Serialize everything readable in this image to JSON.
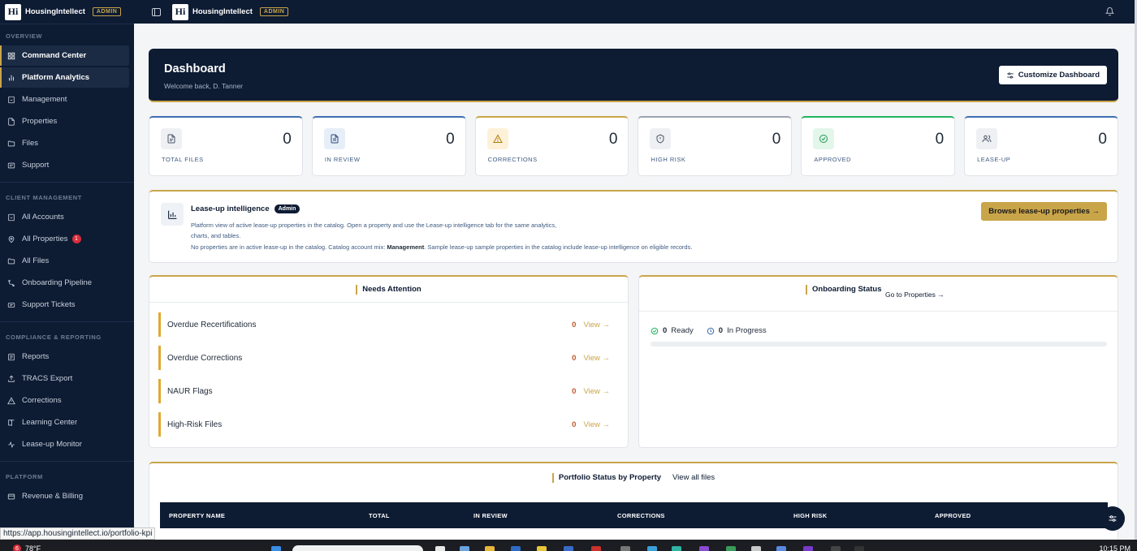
{
  "brand": {
    "name": "HousingIntellect",
    "logo_text": "Hi",
    "role_badge": "ADMIN"
  },
  "sidebar": {
    "sections": [
      {
        "title": "OVERVIEW",
        "items": [
          {
            "label": "Command Center",
            "icon": "grid-icon",
            "active": true
          },
          {
            "label": "Platform Analytics",
            "icon": "bar-chart-icon",
            "active": true
          },
          {
            "label": "Management",
            "icon": "building-icon"
          },
          {
            "label": "Properties",
            "icon": "document-icon"
          },
          {
            "label": "Files",
            "icon": "folder-icon"
          },
          {
            "label": "Support",
            "icon": "support-icon"
          }
        ]
      },
      {
        "title": "CLIENT MANAGEMENT",
        "items": [
          {
            "label": "All Accounts",
            "icon": "building-icon"
          },
          {
            "label": "All Properties",
            "icon": "map-pin-icon",
            "badge": "1"
          },
          {
            "label": "All Files",
            "icon": "folder-icon"
          },
          {
            "label": "Onboarding Pipeline",
            "icon": "route-icon"
          },
          {
            "label": "Support Tickets",
            "icon": "ticket-icon"
          }
        ]
      },
      {
        "title": "COMPLIANCE & REPORTING",
        "items": [
          {
            "label": "Reports",
            "icon": "report-icon"
          },
          {
            "label": "TRACS Export",
            "icon": "export-icon"
          },
          {
            "label": "Corrections",
            "icon": "warning-icon"
          },
          {
            "label": "Learning Center",
            "icon": "book-icon"
          },
          {
            "label": "Lease-up Monitor",
            "icon": "activity-icon"
          }
        ]
      },
      {
        "title": "PLATFORM",
        "items": [
          {
            "label": "Revenue & Billing",
            "icon": "card-icon"
          }
        ]
      }
    ]
  },
  "dashboard": {
    "title": "Dashboard",
    "welcome": "Welcome back, D. Tanner",
    "customize_label": "Customize Dashboard"
  },
  "stats": [
    {
      "label": "TOTAL FILES",
      "value": "0",
      "icon": "file-icon"
    },
    {
      "label": "IN REVIEW",
      "value": "0",
      "icon": "file-text-icon"
    },
    {
      "label": "CORRECTIONS",
      "value": "0",
      "icon": "warning-icon"
    },
    {
      "label": "HIGH RISK",
      "value": "0",
      "icon": "shield-icon"
    },
    {
      "label": "APPROVED",
      "value": "0",
      "icon": "check-circle-icon"
    },
    {
      "label": "LEASE-UP",
      "value": "0",
      "icon": "users-icon"
    }
  ],
  "lease_up": {
    "title": "Lease-up intelligence",
    "badge": "Admin",
    "desc1": "Platform view of active lease-up properties in the catalog. Open a property and use the Lease-up intelligence tab for the same analytics, charts, and tables.",
    "desc2_pre": "No properties are in active lease-up in the catalog. Catalog account mix: ",
    "desc2_bold": "Management",
    "desc2_post": ". Sample lease-up sample properties in the catalog include lease-up intelligence on eligible records.",
    "button_label": "Browse lease-up properties →"
  },
  "needs_attention": {
    "title": "Needs Attention",
    "rows": [
      {
        "label": "Overdue Recertifications",
        "count": "0",
        "link": "View →"
      },
      {
        "label": "Overdue Corrections",
        "count": "0",
        "link": "View →"
      },
      {
        "label": "NAUR Flags",
        "count": "0",
        "link": "View →"
      },
      {
        "label": "High-Risk Files",
        "count": "0",
        "link": "View →"
      }
    ]
  },
  "onboarding": {
    "title": "Onboarding Status",
    "goto_label": "Go to Properties →",
    "ready_count": "0",
    "ready_label": "Ready",
    "progress_count": "0",
    "progress_label": "In Progress"
  },
  "portfolio": {
    "title": "Portfolio Status by Property",
    "view_all": "View all files",
    "columns": [
      "PROPERTY NAME",
      "TOTAL",
      "IN REVIEW",
      "CORRECTIONS",
      "HIGH RISK",
      "APPROVED"
    ]
  },
  "status_url": "https://app.housingintellect.io/portfolio-kpi",
  "taskbar": {
    "weather_badge": "6",
    "temperature": "78°F",
    "time": "10:15 PM"
  },
  "colors": {
    "navy": "#0d1b33",
    "gold": "#c9a54a",
    "danger": "#d92d3a",
    "success": "#22b35e"
  }
}
